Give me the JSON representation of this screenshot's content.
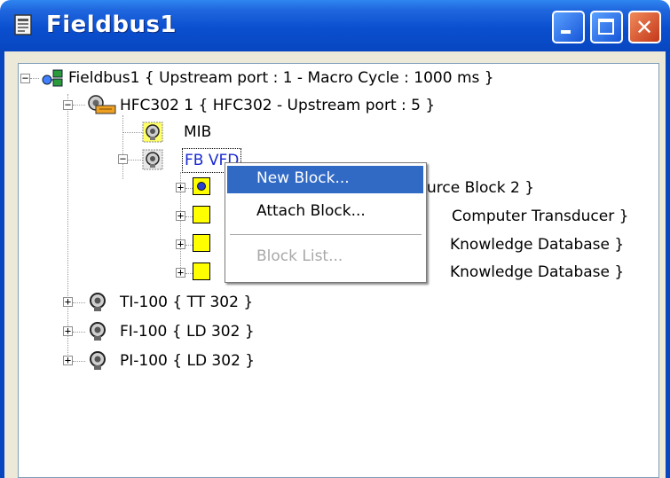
{
  "window": {
    "title": "Fieldbus1",
    "icon": "document-icon"
  },
  "tree": {
    "root": "Fieldbus1 { Upstream port : 1 - Macro Cycle : 1000 ms }",
    "hfc": "HFC302 1 { HFC302 - Upstream port : 5 }",
    "mib": "MIB",
    "fbvfd": "FB VFD",
    "child1_tail": "urce Block 2 }",
    "child2_tail": "Computer Transducer }",
    "child3_tail": "Knowledge Database }",
    "child4_tail": "Knowledge Database }",
    "ti": "TI-100 { TT 302 }",
    "fi": "FI-100 { LD 302 }",
    "pi": "PI-100 { LD 302 }"
  },
  "context_menu": {
    "items": [
      "New Block...",
      "Attach Block...",
      "Block List..."
    ]
  },
  "colors": {
    "highlight": "#316ac5",
    "titlebar": "#0a4fcf"
  }
}
